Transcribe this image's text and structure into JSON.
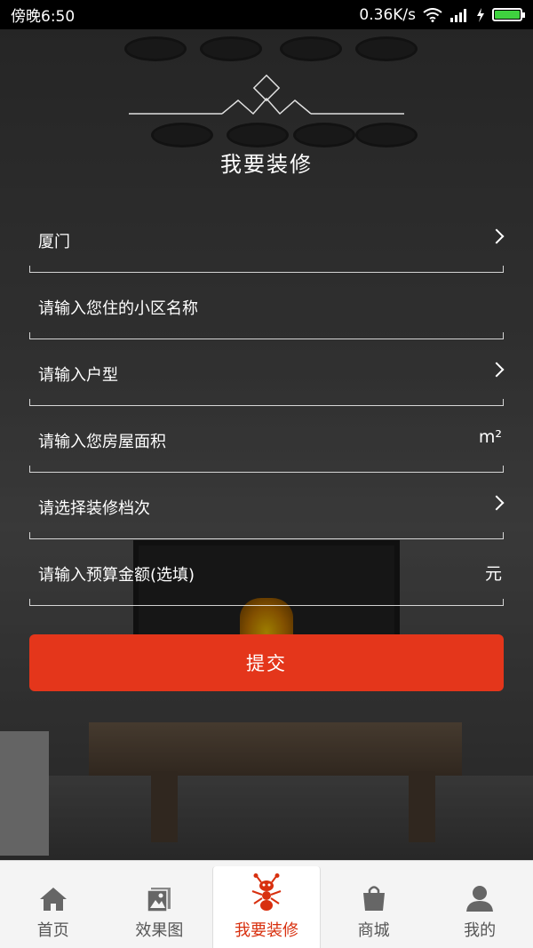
{
  "status_bar": {
    "time": "傍晚6:50",
    "network_speed": "0.36K/s",
    "battery_level": 1.0
  },
  "header": {
    "title": "我要装修"
  },
  "form": {
    "fields": [
      {
        "label": "厦门",
        "suffix": "",
        "has_chevron": true
      },
      {
        "label": "请输入您住的小区名称",
        "suffix": "",
        "has_chevron": false
      },
      {
        "label": "请输入户型",
        "suffix": "",
        "has_chevron": true
      },
      {
        "label": "请输入您房屋面积",
        "suffix": "m²",
        "has_chevron": false
      },
      {
        "label": "请选择装修档次",
        "suffix": "",
        "has_chevron": true
      },
      {
        "label": "请输入预算金额(选填)",
        "suffix": "元",
        "has_chevron": false
      }
    ],
    "submit_label": "提交"
  },
  "bottom_nav": {
    "items": [
      {
        "label": "首页",
        "icon": "home-icon"
      },
      {
        "label": "效果图",
        "icon": "gallery-icon"
      },
      {
        "label": "我要装修",
        "icon": "ant-mascot-icon",
        "active": true
      },
      {
        "label": "商城",
        "icon": "shopping-bag-icon"
      },
      {
        "label": "我的",
        "icon": "user-icon"
      }
    ]
  },
  "colors": {
    "accent": "#e4361b",
    "active_nav": "#d8300f"
  }
}
